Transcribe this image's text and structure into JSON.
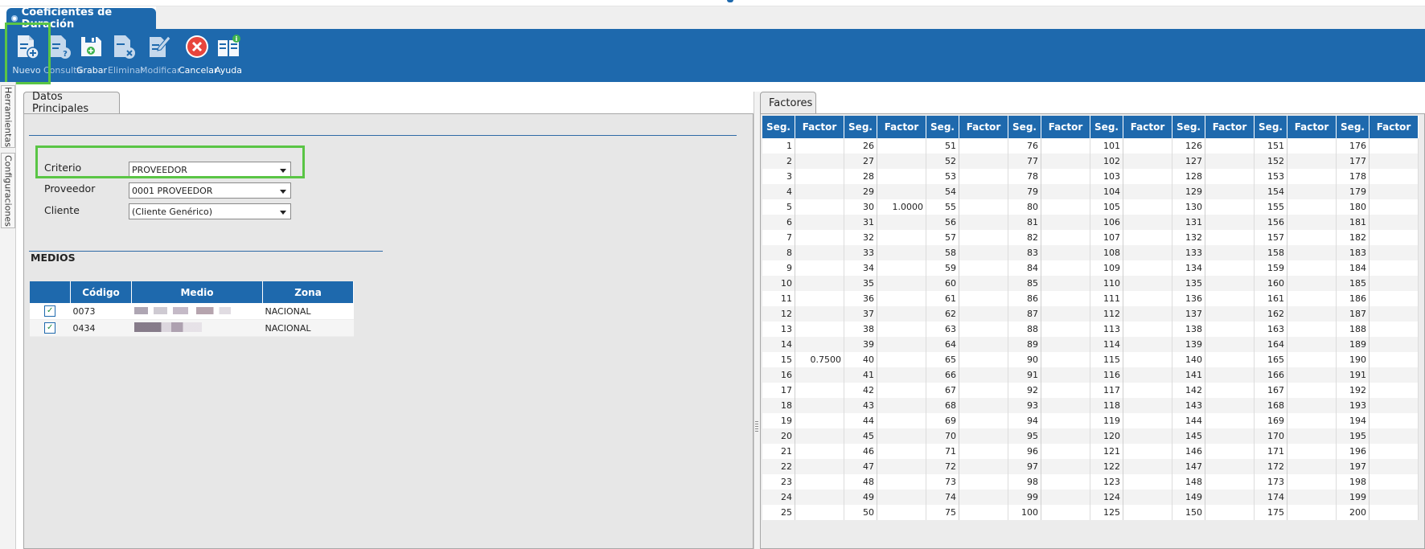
{
  "window_tab": {
    "title": "Coeficientes de Duración"
  },
  "toolbar": {
    "buttons": [
      {
        "label": "Nuevo",
        "icon": "new-document-icon",
        "enabled": true,
        "highlighted": true
      },
      {
        "label": "Consulta",
        "icon": "query-document-icon",
        "enabled": false
      },
      {
        "label": "Grabar",
        "icon": "save-disk-icon",
        "enabled": true
      },
      {
        "label": "Eliminar",
        "icon": "delete-document-icon",
        "enabled": false
      },
      {
        "label": "Modificar",
        "icon": "edit-document-icon",
        "enabled": false
      },
      {
        "label": "Cancelar",
        "icon": "cancel-icon",
        "enabled": true
      },
      {
        "label": "Ayuda",
        "icon": "help-book-icon",
        "enabled": true
      }
    ]
  },
  "sidebar": {
    "tabs": [
      "Herramientas",
      "Configuraciones"
    ]
  },
  "datos_principales": {
    "tab_label": "Datos Principales",
    "fields": [
      {
        "label": "Criterio",
        "value": "PROVEEDOR",
        "highlighted": true
      },
      {
        "label": "Proveedor",
        "value": "0001 PROVEEDOR"
      },
      {
        "label": "Cliente",
        "value": "(Cliente Genérico)"
      }
    ],
    "medios": {
      "title": "MEDIOS",
      "columns": [
        "Código",
        "Medio",
        "Zona"
      ],
      "rows": [
        {
          "checked": true,
          "codigo": "0073",
          "zona": "NACIONAL"
        },
        {
          "checked": true,
          "codigo": "0434",
          "zona": "NACIONAL"
        }
      ]
    }
  },
  "factores": {
    "tab_label": "Factores",
    "columns": [
      "Seg.",
      "Factor",
      "Seg.",
      "Factor",
      "Seg.",
      "Factor",
      "Seg.",
      "Factor",
      "Seg.",
      "Factor",
      "Seg.",
      "Factor",
      "Seg.",
      "Factor",
      "Seg.",
      "Factor"
    ],
    "groups": 8,
    "rows_per_group": 25,
    "seg_start": 1,
    "values": {
      "5": "",
      "15": "0.7500",
      "30": "1.0000"
    }
  },
  "colors": {
    "accent": "#1e69ad",
    "highlight": "#5ac545",
    "cancel": "#e8453c"
  }
}
